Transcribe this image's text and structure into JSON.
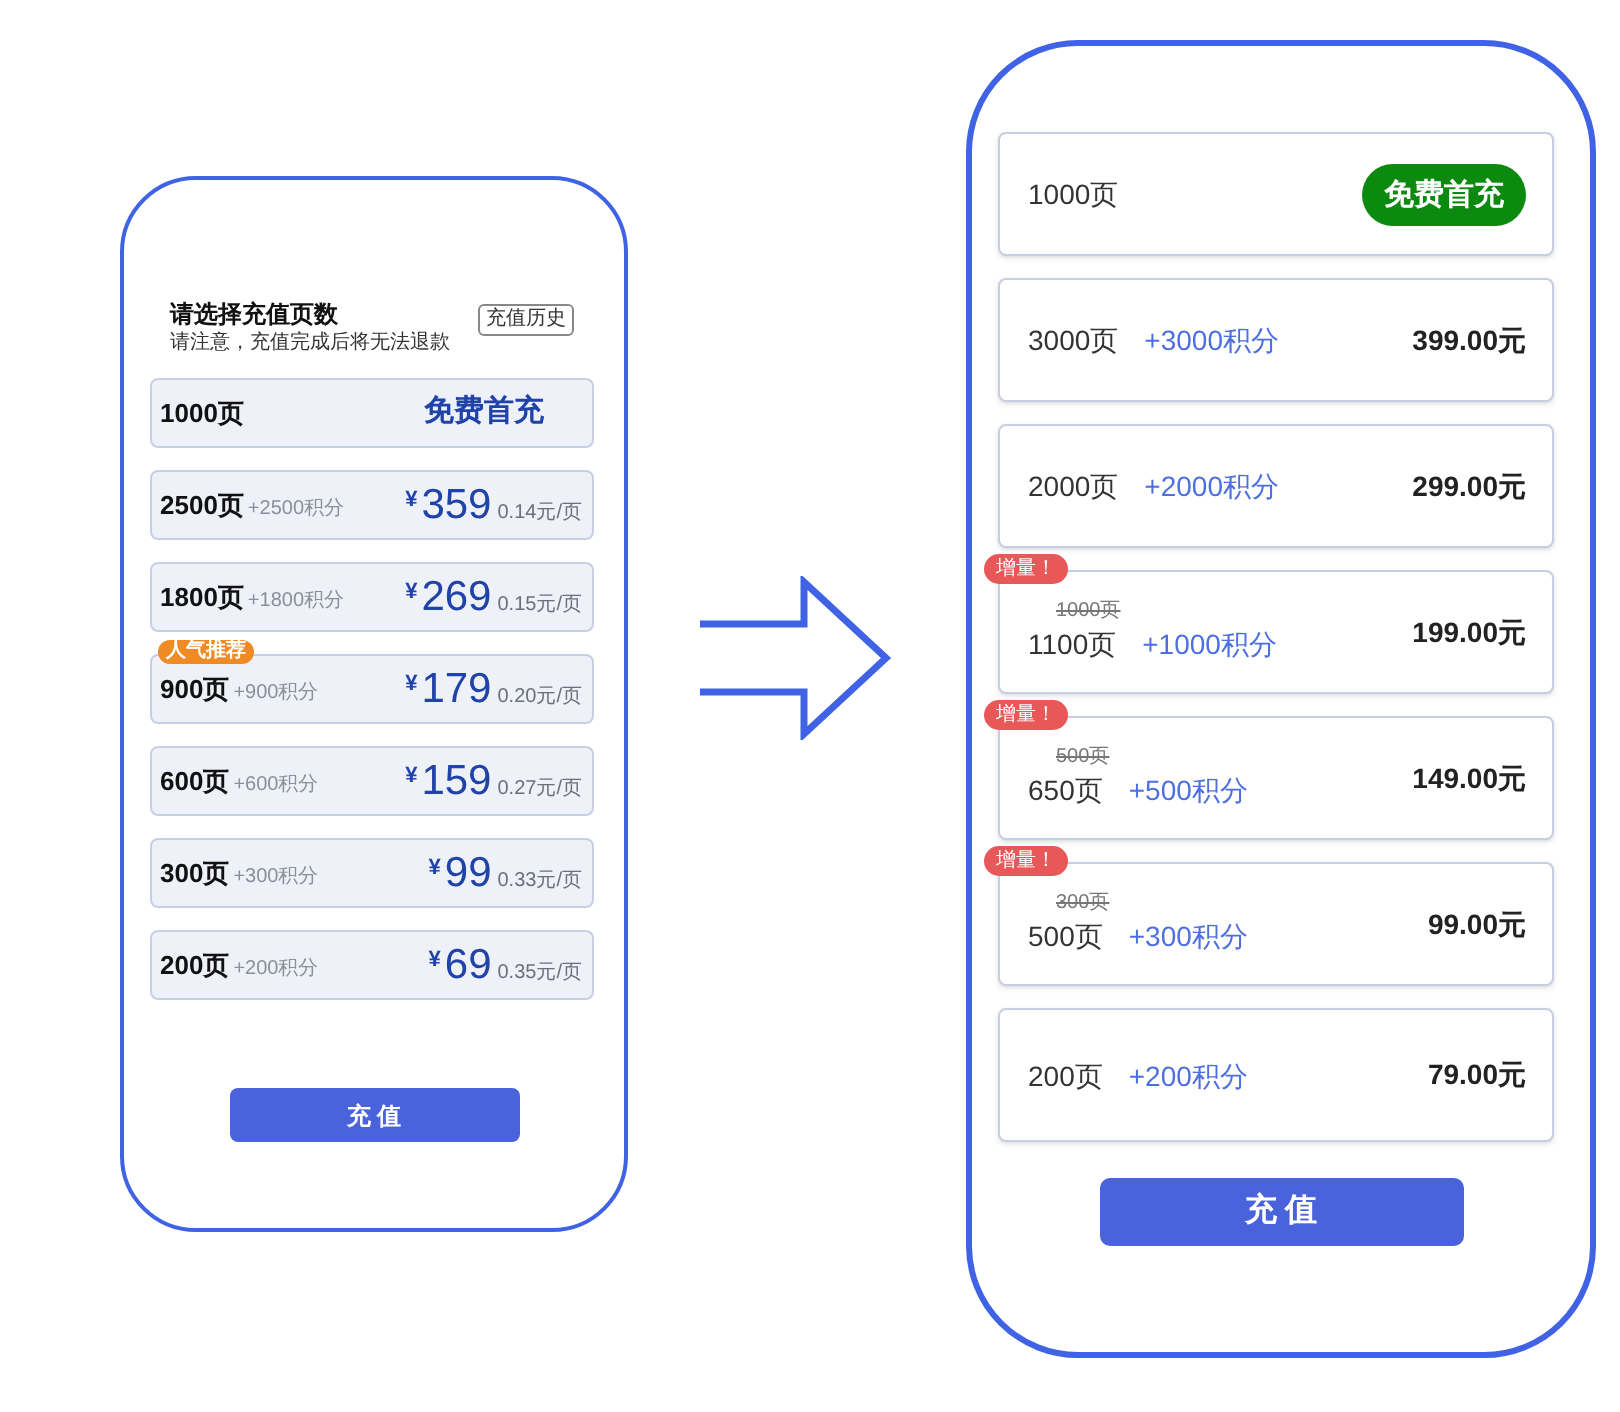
{
  "left_phone": {
    "title": "请选择充值页数",
    "notice": "请注意，充值完成后将无法退款",
    "history_button": "充值历史",
    "options": [
      {
        "kind": "free",
        "pages": "1000页",
        "offer": "免费首充"
      },
      {
        "kind": "paid",
        "pages": "2500页",
        "bonus": "+2500积分",
        "price": "$^{¥}$359",
        "unit_price": "0.14元/页"
      },
      {
        "kind": "paid",
        "pages": "1800页",
        "bonus": "+1800积分",
        "price": "$^{¥}$269",
        "unit_price": "0.15元/页"
      },
      {
        "kind": "paid",
        "badge": "人气推荐",
        "pages": "900页",
        "bonus": "+900积分",
        "price": "$^{¥}$179",
        "unit_price": "0.20元/页"
      },
      {
        "kind": "paid",
        "pages": "600页",
        "bonus": "+600积分",
        "price": "$^{¥}$159",
        "unit_price": "0.27元/页"
      },
      {
        "kind": "paid",
        "pages": "300页",
        "bonus": "+300积分",
        "price": "$^{¥}$99",
        "unit_price": "0.33元/页"
      },
      {
        "kind": "paid",
        "pages": "200页",
        "bonus": "+200积分",
        "price": "$^{¥}$69",
        "unit_price": "0.35元/页"
      }
    ],
    "submit_button": "充 值"
  },
  "right_phone": {
    "options": [
      {
        "kind": "free",
        "pages": "1000页",
        "offer": "免费首充"
      },
      {
        "kind": "paid",
        "pages": "3000页",
        "bonus": "+3000积分",
        "price": "399.00元"
      },
      {
        "kind": "paid",
        "pages": "2000页",
        "bonus": "+2000积分",
        "price": "299.00元"
      },
      {
        "kind": "paid",
        "badge": "增量！",
        "original_pages": "1000页",
        "pages": "1100页",
        "bonus": "+1000积分",
        "price": "199.00元"
      },
      {
        "kind": "paid",
        "badge": "增量！",
        "original_pages": "500页",
        "pages": "650页",
        "bonus": "+500积分",
        "price": "149.00元"
      },
      {
        "kind": "paid",
        "badge": "增量！",
        "original_pages": "300页",
        "pages": "500页",
        "bonus": "+300积分",
        "price": "99.00元"
      },
      {
        "kind": "paid",
        "pages": "200页",
        "bonus": "+200积分",
        "price": "79.00元"
      }
    ],
    "submit_button": "充 值"
  }
}
